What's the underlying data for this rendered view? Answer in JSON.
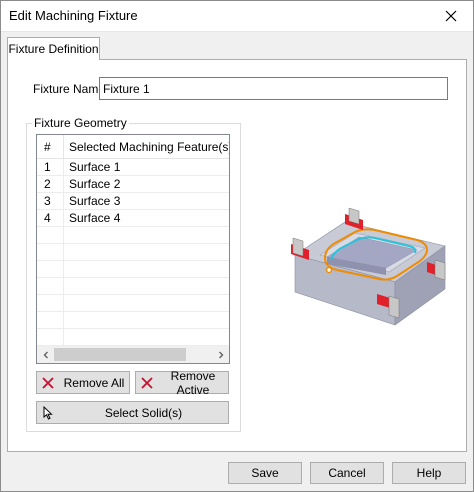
{
  "window": {
    "title": "Edit Machining Fixture"
  },
  "tabs": [
    {
      "label": "Fixture Definition"
    }
  ],
  "fixture_name": {
    "label": "Fixture Name:",
    "value": "Fixture 1"
  },
  "geometry": {
    "legend": "Fixture Geometry",
    "columns": {
      "num": "#",
      "feature": "Selected Machining Feature(s)"
    },
    "rows": [
      {
        "num": "1",
        "feature": "Surface 1"
      },
      {
        "num": "2",
        "feature": "Surface 2"
      },
      {
        "num": "3",
        "feature": "Surface 3"
      },
      {
        "num": "4",
        "feature": "Surface 4"
      }
    ],
    "remove_all": "Remove All",
    "remove_active": "Remove Active",
    "select_solids": "Select Solid(s)"
  },
  "footer": {
    "save": "Save",
    "cancel": "Cancel",
    "help": "Help"
  },
  "colors": {
    "accent_orange": "#f08c00",
    "accent_cyan": "#29c4dc",
    "clamp_red": "#e0202a"
  }
}
